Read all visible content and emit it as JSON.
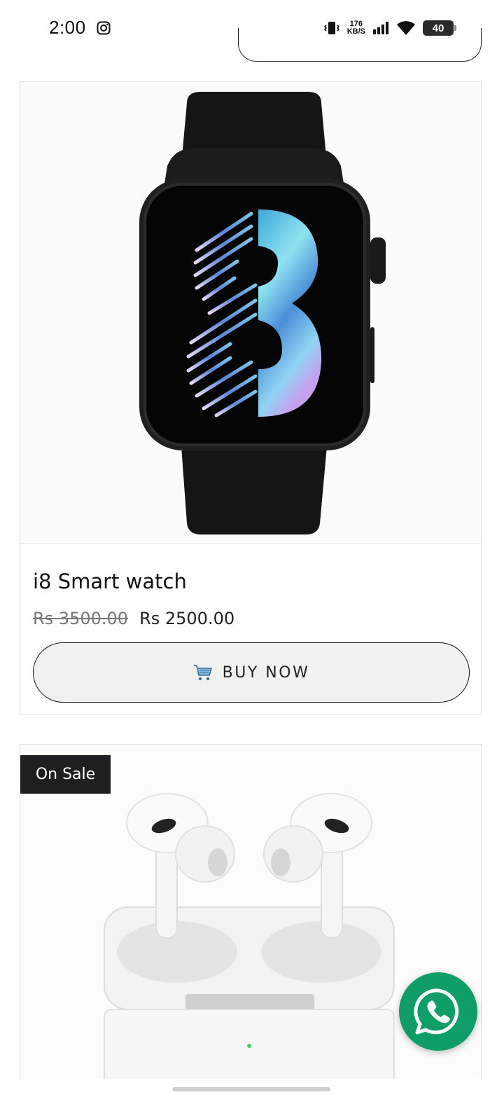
{
  "status_bar": {
    "time": "2:00",
    "net_speed_value": "176",
    "net_speed_unit": "KB/S",
    "battery": "40"
  },
  "products": [
    {
      "title": "i8 Smart watch",
      "price_original": "Rs 3500.00",
      "price_sale": "Rs 2500.00",
      "buy_label": "BUY NOW"
    },
    {
      "badge": "On Sale"
    }
  ],
  "colors": {
    "whatsapp": "#0f9e67",
    "badge_bg": "#1e1f20",
    "button_bg": "#f1f1f1"
  }
}
